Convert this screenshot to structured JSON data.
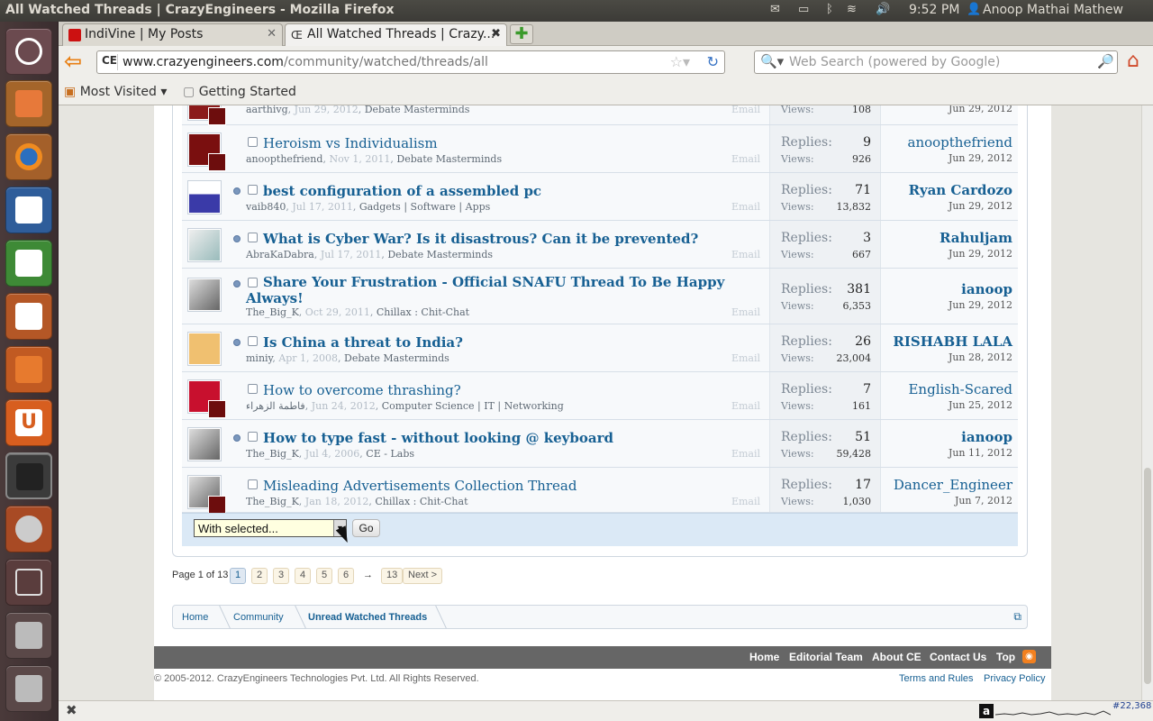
{
  "window": {
    "title": "All Watched Threads | CrazyEngineers - Mozilla Firefox"
  },
  "topbar": {
    "clock": "9:52 PM",
    "user": "Anoop Mathai Mathew"
  },
  "tabs": [
    {
      "label": "IndiVine | My Posts"
    },
    {
      "label": "All Watched Threads | Crazy..."
    }
  ],
  "url": {
    "domain": "www.crazyengineers.com",
    "path": "/community/watched/threads/all",
    "site_icon": "CE"
  },
  "search": {
    "placeholder": "Web Search (powered by Google)"
  },
  "bookmarks": [
    {
      "label": "Most Visited"
    },
    {
      "label": "Getting Started"
    }
  ],
  "partial_row": {
    "meta_user": "aarthivg",
    "meta_date": "Jun 29, 2012",
    "meta_forum": "Debate Masterminds",
    "email": "Email",
    "views_label": "Views:",
    "views": "108",
    "last_date": "Jun 29, 2012"
  },
  "threads": [
    {
      "title": "Heroism vs Individualism",
      "user": "anoopthefriend",
      "date": "Nov 1, 2011",
      "forum": "Debate Masterminds",
      "replies": "9",
      "views": "926",
      "last_user": "anoopthefriend",
      "last_date": "Jun 29, 2012"
    },
    {
      "title": "best configuration of a assembled pc",
      "user": "vaib840",
      "date": "Jul 17, 2011",
      "forum": "Gadgets | Software | Apps",
      "replies": "71",
      "views": "13,832",
      "last_user": "Ryan Cardozo",
      "last_date": "Jun 29, 2012"
    },
    {
      "title": "What is Cyber War? Is it disastrous? Can it be prevented?",
      "user": "AbraKaDabra",
      "date": "Jul 17, 2011",
      "forum": "Debate Masterminds",
      "replies": "3",
      "views": "667",
      "last_user": "Rahuljam",
      "last_date": "Jun 29, 2012"
    },
    {
      "title": "Share Your Frustration - Official SNAFU Thread To Be Happy",
      "title2": "Always!",
      "user": "The_Big_K",
      "date": "Oct 29, 2011",
      "forum": "Chillax : Chit-Chat",
      "replies": "381",
      "views": "6,353",
      "last_user": "ianoop",
      "last_date": "Jun 29, 2012"
    },
    {
      "title": "Is China a threat to India?",
      "user": "miniy",
      "date": "Apr 1, 2008",
      "forum": "Debate Masterminds",
      "replies": "26",
      "views": "23,004",
      "last_user": "RISHABH LALA",
      "last_date": "Jun 28, 2012"
    },
    {
      "title": "How to overcome thrashing?",
      "user": "فاطمة الزهراء",
      "date": "Jun 24, 2012",
      "forum": "Computer Science | IT | Networking",
      "replies": "7",
      "views": "161",
      "last_user": "English-Scared",
      "last_date": "Jun 25, 2012"
    },
    {
      "title": "How to type fast - without looking @ keyboard",
      "user": "The_Big_K",
      "date": "Jul 4, 2006",
      "forum": "CE - Labs",
      "replies": "51",
      "views": "59,428",
      "last_user": "ianoop",
      "last_date": "Jun 11, 2012"
    },
    {
      "title": "Misleading Advertisements Collection Thread",
      "user": "The_Big_K",
      "date": "Jan 18, 2012",
      "forum": "Chillax : Chit-Chat",
      "replies": "17",
      "views": "1,030",
      "last_user": "Dancer_Engineer",
      "last_date": "Jun 7, 2012"
    }
  ],
  "labels": {
    "replies": "Replies:",
    "views": "Views:",
    "email": "Email"
  },
  "bulk": {
    "select_value": "With selected...",
    "go": "Go"
  },
  "pager": {
    "label": "Page 1 of 13",
    "pages": [
      "1",
      "2",
      "3",
      "4",
      "5",
      "6"
    ],
    "ellipsis": "→",
    "last": "13",
    "next": "Next >"
  },
  "breadcrumbs": [
    "Home",
    "Community",
    "Unread Watched Threads"
  ],
  "footer": {
    "links": [
      "Home",
      "Editorial Team",
      "About CE",
      "Contact Us",
      "Top"
    ],
    "copyright": "© 2005-2012. CrazyEngineers Technologies Pvt. Ltd. All Rights Reserved.",
    "terms": "Terms and Rules",
    "privacy": "Privacy Policy"
  },
  "addon": {
    "rank": "#22,368",
    "alexa_glyph": "a"
  }
}
